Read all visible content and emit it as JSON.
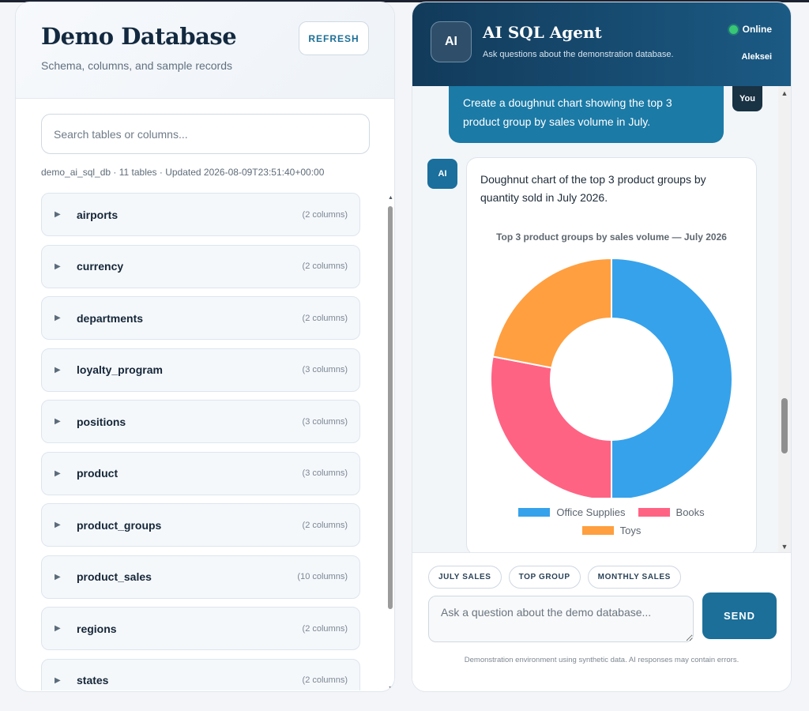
{
  "schema": {
    "title": "Demo Database",
    "subtitle": "Schema, columns, and sample records",
    "refresh_label": "REFRESH",
    "search_placeholder": "Search tables or columns...",
    "meta": "demo_ai_sql_db · 11 tables · Updated 2026-08-09T23:51:40+00:00",
    "tables": [
      {
        "name": "airports",
        "columns": "(2 columns)"
      },
      {
        "name": "currency",
        "columns": "(2 columns)"
      },
      {
        "name": "departments",
        "columns": "(2 columns)"
      },
      {
        "name": "loyalty_program",
        "columns": "(3 columns)"
      },
      {
        "name": "positions",
        "columns": "(3 columns)"
      },
      {
        "name": "product",
        "columns": "(3 columns)"
      },
      {
        "name": "product_groups",
        "columns": "(2 columns)"
      },
      {
        "name": "product_sales",
        "columns": "(10 columns)"
      },
      {
        "name": "regions",
        "columns": "(2 columns)"
      },
      {
        "name": "states",
        "columns": "(2 columns)"
      }
    ]
  },
  "chat": {
    "logo": "AI",
    "title": "AI SQL Agent",
    "subtitle": "Ask questions about the demonstration database.",
    "status": "Online",
    "username": "Aleksei",
    "status_color": "#38c775",
    "messages": {
      "user_text": "Create a doughnut chart showing the top 3 product group by sales volume in July.",
      "user_badge": "You",
      "ai_badge": "AI",
      "ai_text": "Doughnut chart of the top 3 product groups by quantity sold in July 2026."
    },
    "chips": [
      "JULY SALES",
      "TOP GROUP",
      "MONTHLY SALES"
    ],
    "input_placeholder": "Ask a question about the demo database...",
    "send_label": "SEND",
    "disclaimer": "Demonstration environment using synthetic data. AI responses may contain errors."
  },
  "chart_data": {
    "type": "pie",
    "variant": "doughnut",
    "title": "Top 3 product groups by sales volume — July 2026",
    "categories": [
      "Office Supplies",
      "Books",
      "Toys"
    ],
    "values": [
      50,
      28,
      22
    ],
    "colors": [
      "#36a2eb",
      "#ff6384",
      "#ff9f40"
    ],
    "legend_position": "bottom"
  }
}
